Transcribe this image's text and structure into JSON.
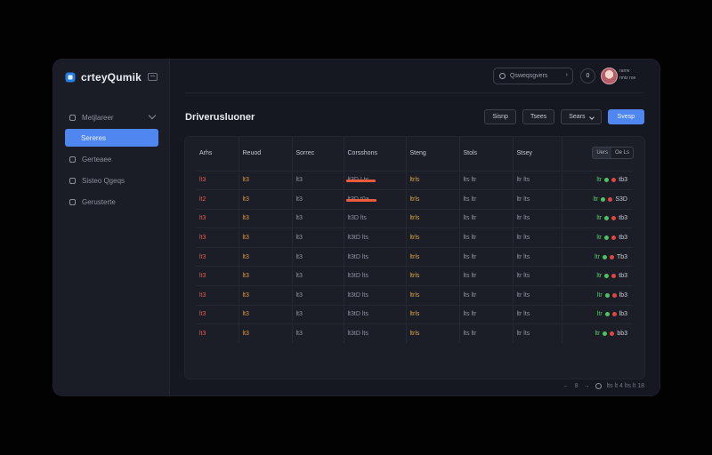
{
  "app": {
    "name": "crteyQumik"
  },
  "sidebar": {
    "group": {
      "label": "Metjlareer"
    },
    "items": [
      {
        "label": "Sereres",
        "active": true
      },
      {
        "label": "Gerteaee"
      },
      {
        "label": "Sisteo Qgeqs"
      },
      {
        "label": "Gerusterte"
      }
    ]
  },
  "topbar": {
    "search_placeholder": "Qsweqsgvers",
    "search_arrow": "›",
    "notification": "0",
    "user_line1": "rarrw",
    "user_line2": "rmtz roe"
  },
  "page": {
    "title": "Driverusluoner"
  },
  "actions": {
    "filter_label": "Sisnp",
    "sort_label": "Tsees",
    "view_label": "Sears",
    "primary_label": "Svesp"
  },
  "table": {
    "columns": [
      "Arhs",
      "Reuod",
      "Sorrec",
      "Corsshons",
      "Steng",
      "Stols",
      "Stsey"
    ],
    "toggle": [
      "Uers",
      "Oe Ls"
    ],
    "rows": [
      {
        "c1": "lt3",
        "c2": "lt3",
        "c3": "lt3",
        "c4": "lt3D Lts",
        "c5": "ltrls",
        "c6": "lts ltr",
        "c7": "ltr lts",
        "v": "ltr",
        "s1": "g",
        "s2": "r",
        "n": "tb3"
      },
      {
        "c1": "lt2",
        "c2": "lt3",
        "c3": "lt3",
        "c4": "lt3D t0a",
        "c5": "ltrls",
        "c6": "lts ltr",
        "c7": "ltr lts",
        "v": "ltr",
        "s1": "g",
        "s2": "r",
        "n": "S3D"
      },
      {
        "c1": "lt3",
        "c2": "lt3",
        "c3": "lt3",
        "c4": "lt3D lts",
        "c5": "ltrls",
        "c6": "lts ltr",
        "c7": "ltr lts",
        "v": "ltr",
        "s1": "g",
        "s2": "r",
        "n": "tb3"
      },
      {
        "c1": "lt3",
        "c2": "lt3",
        "c3": "lt3",
        "c4": "lt3tD lts",
        "c5": "ltrls",
        "c6": "lts ltr",
        "c7": "ltr lts",
        "v": "ltr",
        "s1": "g",
        "s2": "r",
        "n": "tb3"
      },
      {
        "c1": "lt3",
        "c2": "lt3",
        "c3": "lt3",
        "c4": "lt3tD lts",
        "c5": "ltrls",
        "c6": "lts ltr",
        "c7": "ltr lts",
        "v": "ltr",
        "s1": "g",
        "s2": "r",
        "n": "Tb3"
      },
      {
        "c1": "lt3",
        "c2": "lt3",
        "c3": "lt3",
        "c4": "lt3tD lts",
        "c5": "ltrls",
        "c6": "lts ltr",
        "c7": "ltr lts",
        "v": "ltr",
        "s1": "g",
        "s2": "r",
        "n": "tb3"
      },
      {
        "c1": "lt3",
        "c2": "lt3",
        "c3": "lt3",
        "c4": "lt3tD lts",
        "c5": "ltrls",
        "c6": "lts ltr",
        "c7": "ltr lts",
        "v": "ltr",
        "s1": "g",
        "s2": "r",
        "n": "lb3"
      },
      {
        "c1": "lt3",
        "c2": "lt3",
        "c3": "lt3",
        "c4": "lt3tD lts",
        "c5": "ltrls",
        "c6": "lts ltr",
        "c7": "ltr lts",
        "v": "ltr",
        "s1": "g",
        "s2": "r",
        "n": "lb3"
      },
      {
        "c1": "lt3",
        "c2": "lt3",
        "c3": "lt3",
        "c4": "lt3tD lts",
        "c5": "ltrls",
        "c6": "lts ltr",
        "c7": "ltr lts",
        "v": "ltr",
        "s1": "g",
        "s2": "r",
        "n": "bb3"
      }
    ]
  },
  "pager": {
    "prev": "←",
    "page": "8",
    "next": "→",
    "summary": "lts lt 4 lts lt 18"
  },
  "colors": {
    "accent": "#4f86ef",
    "danger": "#e35a55",
    "warning": "#e4933f",
    "success": "#5bc96c"
  }
}
